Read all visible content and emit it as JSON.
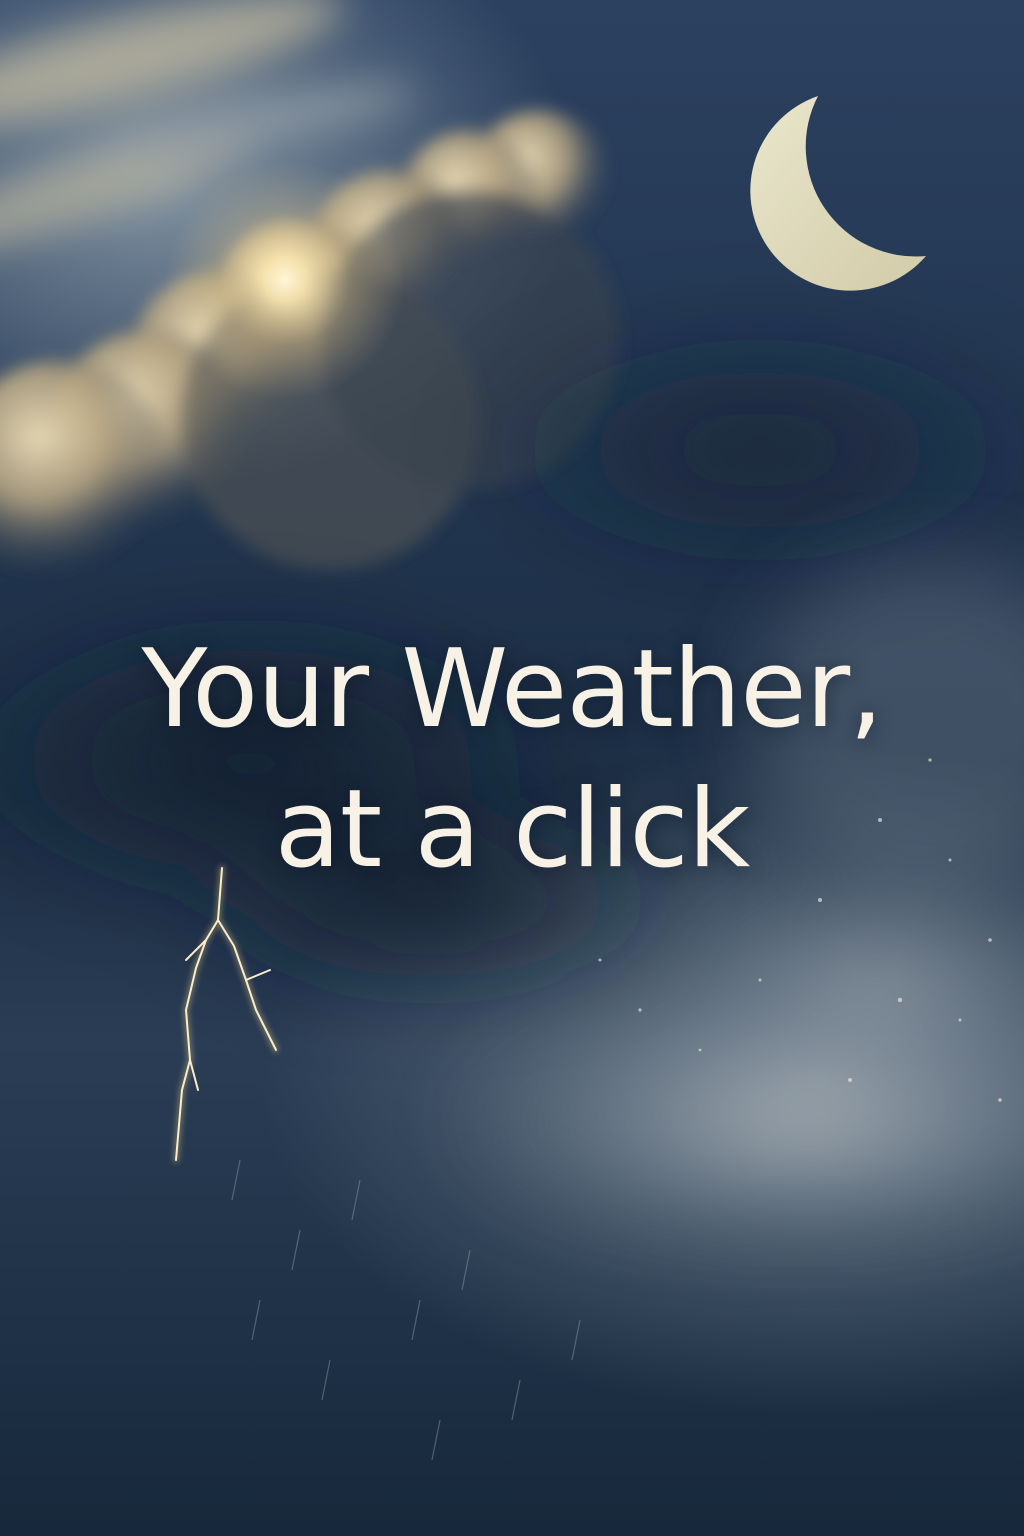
{
  "headline": {
    "line1": "Your Weather,",
    "line2": "at a click"
  },
  "scene": {
    "elements": [
      "sun-glow",
      "cumulus-cloud",
      "crescent-moon",
      "storm-cloud",
      "lightning-bolt",
      "mist-band",
      "rain-streaks",
      "snow-specks"
    ]
  },
  "colors": {
    "sky_dark": "#1d2f45",
    "sky_light": "#4a6480",
    "cloud_warm": "#e8d6ad",
    "moon": "#ece6c6",
    "text": "#f8f2e6",
    "lightning": "#f6e8c0"
  }
}
